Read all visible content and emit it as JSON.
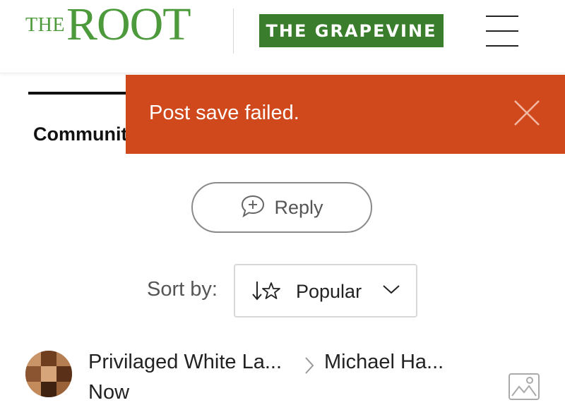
{
  "header": {
    "logo_the": "THE",
    "logo_root": "ROOT",
    "section_button": "THE GRAPEVINE",
    "menu_icon": "hamburger-icon"
  },
  "tabs": {
    "community_label": "Communit"
  },
  "toast": {
    "message": "Post save failed.",
    "close_icon": "close-icon",
    "background": "#d0491c"
  },
  "reply": {
    "label": "Reply",
    "icon": "speech-bubble-plus-icon"
  },
  "sort": {
    "label": "Sort by:",
    "selected": "Popular",
    "icon": "sort-star-icon",
    "chevron": "chevron-down-icon"
  },
  "comment": {
    "author": "Privilaged White La...",
    "reply_to": "Michael Ha...",
    "timestamp": "Now",
    "image_icon": "image-icon"
  },
  "colors": {
    "brand_green": "#4d9a3c",
    "grapevine_green": "#3a7d2c",
    "error": "#d0491c"
  }
}
